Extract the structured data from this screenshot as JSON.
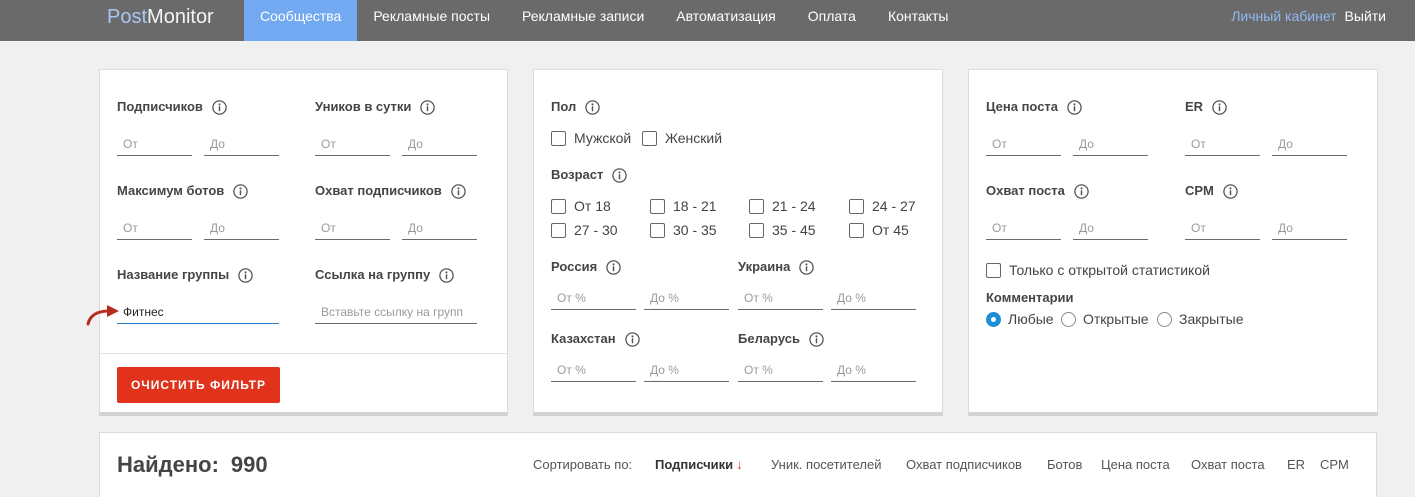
{
  "nav": {
    "logo_part1": "Post",
    "logo_part2": "Monitor",
    "items": [
      {
        "label": "Сообщества",
        "active": true
      },
      {
        "label": "Рекламные посты",
        "active": false
      },
      {
        "label": "Рекламные записи",
        "active": false
      },
      {
        "label": "Автоматизация",
        "active": false
      },
      {
        "label": "Оплата",
        "active": false
      },
      {
        "label": "Контакты",
        "active": false
      }
    ],
    "account_label": "Личный кабинет",
    "logout_label": "Выйти"
  },
  "audience": {
    "subscribers": {
      "label": "Подписчиков",
      "from_placeholder": "От",
      "to_placeholder": "До"
    },
    "uniques_per_day": {
      "label": "Уников в сутки",
      "from_placeholder": "От",
      "to_placeholder": "До"
    },
    "max_bots": {
      "label": "Максимум ботов",
      "from_placeholder": "От",
      "to_placeholder": "До"
    },
    "subscriber_reach": {
      "label": "Охват подписчиков",
      "from_placeholder": "От",
      "to_placeholder": "До"
    },
    "group_name": {
      "label": "Название группы",
      "value": "Фитнес"
    },
    "group_link": {
      "label": "Ссылка на группу",
      "placeholder": "Вставьте ссылку на групп"
    },
    "clear_button": "ОЧИСТИТЬ ФИЛЬТР"
  },
  "demographics": {
    "gender": {
      "label": "Пол",
      "options": [
        {
          "label": "Мужской",
          "checked": false
        },
        {
          "label": "Женский",
          "checked": false
        }
      ]
    },
    "age": {
      "label": "Возраст",
      "options": [
        {
          "label": "От 18",
          "checked": false
        },
        {
          "label": "18 - 21",
          "checked": false
        },
        {
          "label": "21 - 24",
          "checked": false
        },
        {
          "label": "24 - 27",
          "checked": false
        },
        {
          "label": "27 - 30",
          "checked": false
        },
        {
          "label": "30 - 35",
          "checked": false
        },
        {
          "label": "35 - 45",
          "checked": false
        },
        {
          "label": "От 45",
          "checked": false
        }
      ]
    },
    "countries": [
      {
        "label": "Россия",
        "from_placeholder": "От %",
        "to_placeholder": "До %"
      },
      {
        "label": "Украина",
        "from_placeholder": "От %",
        "to_placeholder": "До %"
      },
      {
        "label": "Казахстан",
        "from_placeholder": "От %",
        "to_placeholder": "До %"
      },
      {
        "label": "Беларусь",
        "from_placeholder": "От %",
        "to_placeholder": "До %"
      }
    ]
  },
  "post_metrics": {
    "post_price": {
      "label": "Цена поста",
      "from_placeholder": "От",
      "to_placeholder": "До"
    },
    "er": {
      "label": "ER",
      "from_placeholder": "От",
      "to_placeholder": "До"
    },
    "post_reach": {
      "label": "Охват поста",
      "from_placeholder": "От",
      "to_placeholder": "До"
    },
    "cpm": {
      "label": "CPM",
      "from_placeholder": "От",
      "to_placeholder": "До"
    },
    "open_stats_only": {
      "label": "Только с открытой статистикой",
      "checked": false
    },
    "comments": {
      "label": "Комментарии",
      "options": [
        {
          "label": "Любые",
          "selected": true
        },
        {
          "label": "Открытые",
          "selected": false
        },
        {
          "label": "Закрытые",
          "selected": false
        }
      ]
    }
  },
  "results": {
    "found_label": "Найдено:",
    "found_count": "990",
    "sort_label": "Сортировать по:",
    "sort_options": [
      {
        "label": "Подписчики",
        "active": true,
        "direction_glyph": "↓"
      },
      {
        "label": "Уник. посетителей",
        "active": false
      },
      {
        "label": "Охват подписчиков",
        "active": false
      },
      {
        "label": "Ботов",
        "active": false
      },
      {
        "label": "Цена поста",
        "active": false
      },
      {
        "label": "Охват поста",
        "active": false
      },
      {
        "label": "ER",
        "active": false
      },
      {
        "label": "CPM",
        "active": false
      }
    ]
  },
  "icons": {
    "field_hint": "info-icon",
    "pointer": "curved-arrow-icon",
    "checkbox": "checkbox-icon",
    "radio": "radio-icon"
  },
  "colors": {
    "nav_bg": "#6a6a6a",
    "active_tab": "#72a9f1",
    "accent": "#1e8fd6",
    "danger": "#e1331b",
    "page_bg": "#f0f0f0",
    "link": "#8fbaf3"
  }
}
